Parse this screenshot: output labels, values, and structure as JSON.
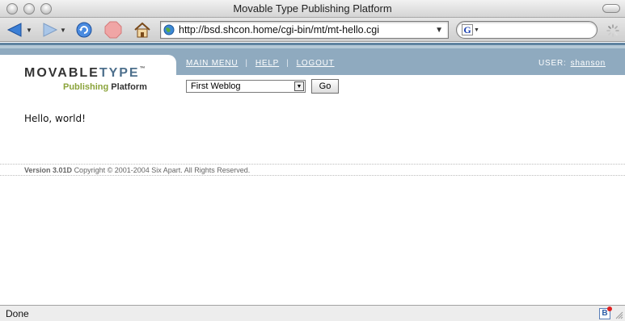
{
  "window": {
    "title": "Movable Type Publishing Platform"
  },
  "toolbar": {
    "url": "http://bsd.shcon.home/cgi-bin/mt/mt-hello.cgi",
    "search_engine_glyph": "G"
  },
  "logo": {
    "word_a": "MOVABLE",
    "word_b": "TYPE",
    "tm": "™",
    "sub_a": "Publishing",
    "sub_b": "Platform"
  },
  "nav": {
    "main_menu": "MAIN MENU",
    "help": "HELP",
    "logout": "LOGOUT",
    "separator": "|"
  },
  "user": {
    "label": "USER:",
    "name": "shanson"
  },
  "blog_selector": {
    "selected": "First Weblog",
    "go_label": "Go"
  },
  "content": {
    "message": "Hello, world!"
  },
  "footer": {
    "version": "Version 3.01D",
    "copyright": "Copyright © 2001-2004 Six Apart. All Rights Reserved."
  },
  "status": {
    "text": "Done"
  },
  "colors": {
    "header_blue": "#8faabf",
    "accent_blue": "#5f83a0",
    "logo_green": "#8aa33a"
  },
  "icons": [
    "back-arrow-icon",
    "forward-arrow-icon",
    "reload-icon",
    "stop-icon",
    "home-icon",
    "globe-icon",
    "google-icon",
    "spinner-icon",
    "status-badge-icon"
  ]
}
